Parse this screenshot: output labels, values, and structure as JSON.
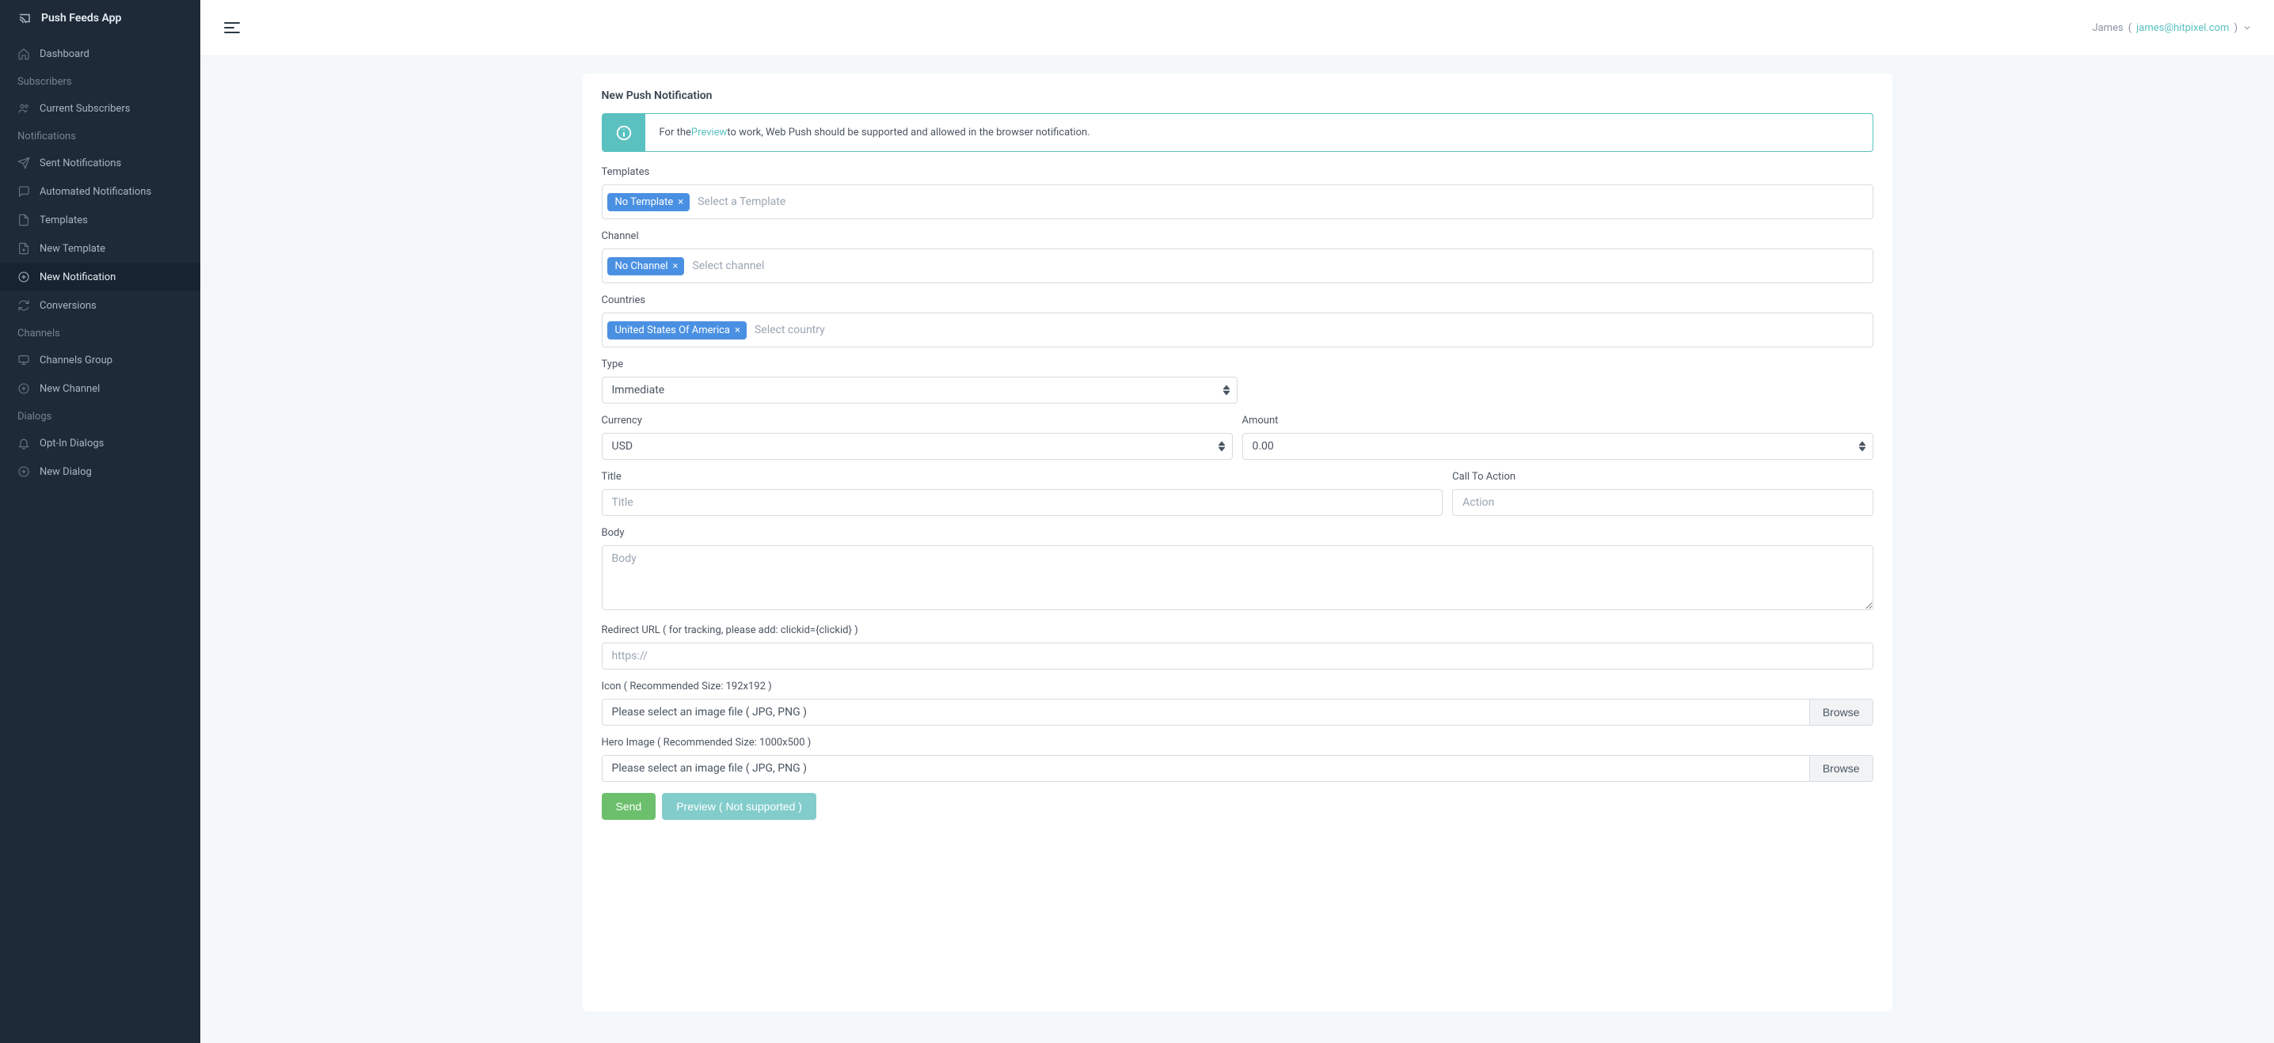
{
  "brand": {
    "title": "Push Feeds App"
  },
  "sidebar": {
    "items": {
      "dashboard": "Dashboard",
      "subscribers_heading": "Subscribers",
      "current_subscribers": "Current Subscribers",
      "notifications_heading": "Notifications",
      "sent_notifications": "Sent Notifications",
      "automated_notifications": "Automated Notifications",
      "templates": "Templates",
      "new_template": "New Template",
      "new_notification": "New Notification",
      "conversions": "Conversions",
      "channels_heading": "Channels",
      "channels_group": "Channels Group",
      "new_channel": "New Channel",
      "dialogs_heading": "Dialogs",
      "opt_in_dialogs": "Opt-In Dialogs",
      "new_dialog": "New Dialog"
    }
  },
  "topbar": {
    "user_name": "James",
    "user_email": "james@hitpixel.com"
  },
  "page": {
    "title": "New Push Notification",
    "alert_pre": "For the ",
    "alert_link": "Preview",
    "alert_post": " to work, Web Push should be supported and allowed in the browser notification.",
    "labels": {
      "templates": "Templates",
      "channel": "Channel",
      "countries": "Countries",
      "type": "Type",
      "currency": "Currency",
      "amount": "Amount",
      "title": "Title",
      "cta": "Call To Action",
      "body": "Body",
      "redirect": "Redirect URL ( for tracking, please add: clickid={clickid} )",
      "icon": "Icon ( Recommended Size: 192x192 )",
      "hero": "Hero Image ( Recommended Size: 1000x500 )"
    },
    "placeholders": {
      "template": "Select a Template",
      "channel": "Select channel",
      "country": "Select country",
      "title": "Title",
      "cta": "Action",
      "body": "Body",
      "redirect": "https://"
    },
    "tags": {
      "no_template": "No Template",
      "no_channel": "No Channel",
      "country_usa": "United States Of America"
    },
    "selects": {
      "type": "Immediate",
      "currency": "USD",
      "amount": "0.00"
    },
    "file": {
      "placeholder": "Please select an image file ( JPG, PNG )",
      "browse": "Browse"
    },
    "buttons": {
      "send": "Send",
      "preview": "Preview ( Not supported )"
    }
  }
}
